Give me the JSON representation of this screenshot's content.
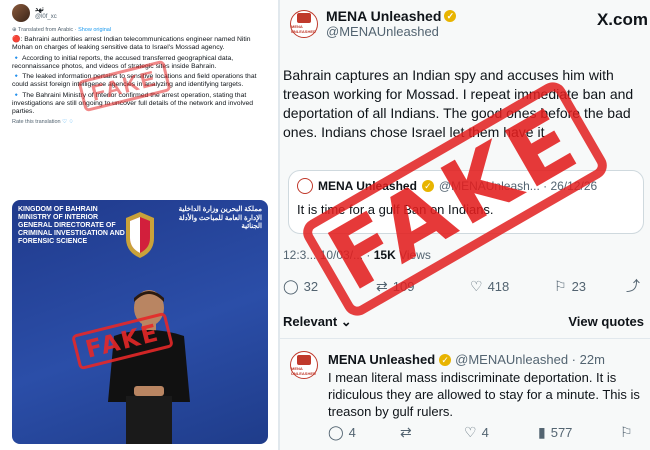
{
  "left_post": {
    "name": "نهد",
    "handle": "@l0f_xc",
    "translated_label": "Translated from Arabic",
    "show_original": "Show original",
    "paragraphs": [
      "🔴: Bahraini authorities arrest Indian telecommunications engineer named Nitin Mohan on charges of leaking sensitive data to Israel's Mossad agency.",
      "🔹 According to initial reports, the accused transferred geographical data, reconnaissance photos, and videos of strategic sites inside Bahrain.",
      "🔹 The leaked information pertains to sensitive locations and field operations that could assist foreign intelligence agencies in analyzing and identifying targets.",
      "🔹 The Bahraini Ministry of Interior confirmed the arrest operation, stating that investigations are still ongoing to uncover full details of the network and involved parties."
    ],
    "rate_label": "Rate this translation",
    "photo": {
      "en_title": "KINGDOM OF BAHRAIN MINISTRY OF INTERIOR GENERAL DIRECTORATE OF CRIMINAL INVESTIGATION AND FORENSIC SCIENCE",
      "ar_title": "مملكة البحرين وزارة الداخلية الإدارة العامة للمباحث والأدلة الجنائية"
    },
    "stamp_text": "FAKE",
    "stamp_color": "#e62828"
  },
  "right_post": {
    "name": "MENA Unleashed",
    "handle": "@MENAUnleashed",
    "x_logo": "X.com",
    "avatar_text": "MENA UNLEASHED",
    "text": "Bahrain captures an Indian spy and accuses him with treason working for Mossad. I repeat immediate ban and deportation of all Indians. The good ones before the bad ones. Indians chose Israel let them have it",
    "quote": {
      "name": "MENA Unleashed",
      "handle_date": "@MENAUnleash... · 26/12/26",
      "text": "It is time for a gulf Ban on Indians."
    },
    "meta_time": "12:3... 10/03/... · ",
    "meta_views": "15K",
    "meta_views_label": "Views",
    "stats": {
      "replies": "32",
      "reposts": "109",
      "likes": "418",
      "bookmarks": "23"
    },
    "relevant_label": "Relevant ⌄",
    "view_quotes_label": "View quotes",
    "stamp_text": "FAKE",
    "stamp_color": "#e21e1e"
  },
  "reply": {
    "name": "MENA Unleashed",
    "handle_time": "@MENAUnleashed · 22m",
    "text": "I mean literal mass indiscriminate deportation. It is ridiculous they are allowed to stay for a minute. This is treason by gulf rulers.",
    "stats": {
      "replies": "4",
      "likes": "4",
      "views": "577"
    }
  },
  "colors": {
    "accent": "#1d9bf0",
    "muted": "#536471",
    "verified": "#e8b400"
  }
}
